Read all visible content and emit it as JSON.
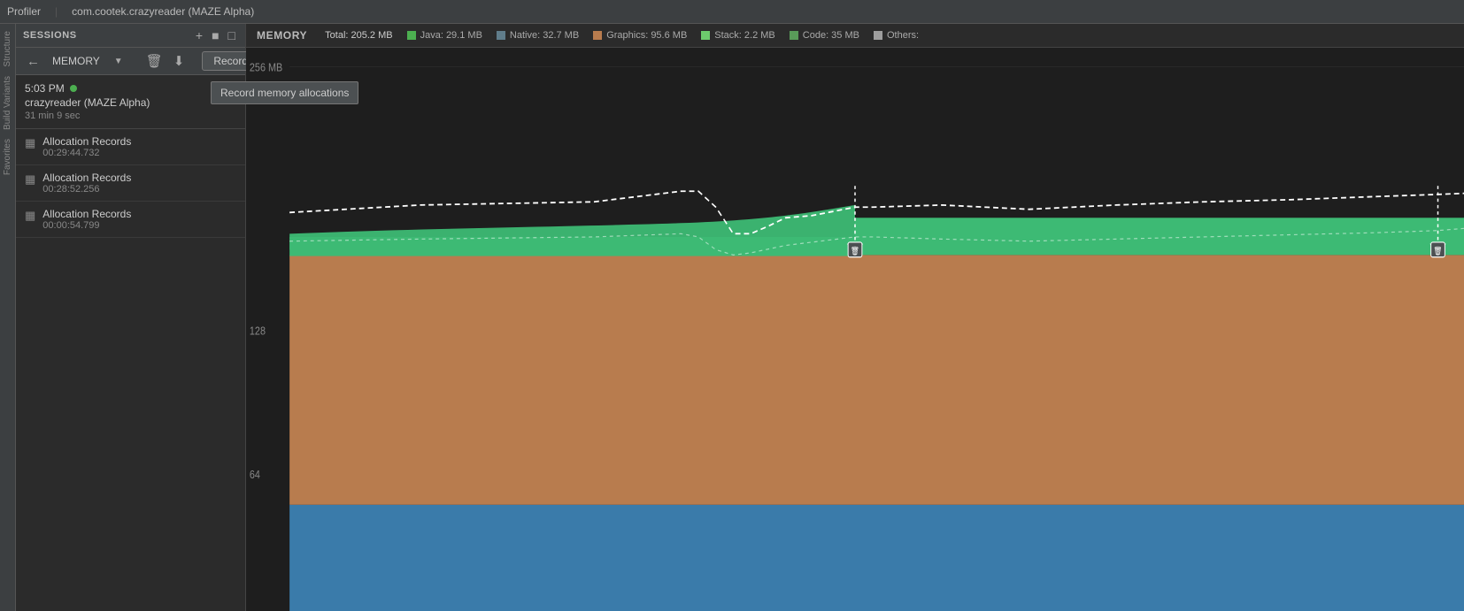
{
  "topbar": {
    "profiler_label": "Profiler",
    "app_label": "com.cootek.crazyreader (MAZE Alpha)"
  },
  "sessions_panel": {
    "title": "SESSIONS",
    "add_btn": "+",
    "stop_btn": "■",
    "toggle_btn": "□",
    "session": {
      "time": "5:03 PM",
      "app": "crazyreader (MAZE Alpha)",
      "duration": "31 min 9 sec"
    },
    "allocation_records": [
      {
        "name": "Allocation Records",
        "timestamp": "00:29:44.732"
      },
      {
        "name": "Allocation Records",
        "timestamp": "00:28:52.256"
      },
      {
        "name": "Allocation Records",
        "timestamp": "00:00:54.799"
      }
    ]
  },
  "toolbar": {
    "memory_label": "MEMORY",
    "record_label": "Record",
    "tooltip": "Record memory allocations"
  },
  "memory_panel": {
    "title": "MEMORY",
    "total": "Total: 205.2 MB",
    "java": "Java: 29.1 MB",
    "native": "Native: 32.7 MB",
    "graphics": "Graphics: 95.6 MB",
    "stack": "Stack: 2.2 MB",
    "code": "Code: 35 MB",
    "others": "Others:",
    "y_labels": [
      "256 MB",
      "128",
      "64"
    ],
    "colors": {
      "java": "#4caf50",
      "native": "#607d8b",
      "graphics": "#b87c4e",
      "stack": "#5b9dcc",
      "code": "#6dcc6d",
      "others": "#9e9e9e"
    }
  },
  "vertical_tabs": [
    {
      "label": "Structure"
    },
    {
      "label": "Build Variants"
    },
    {
      "label": "Favorites"
    }
  ]
}
